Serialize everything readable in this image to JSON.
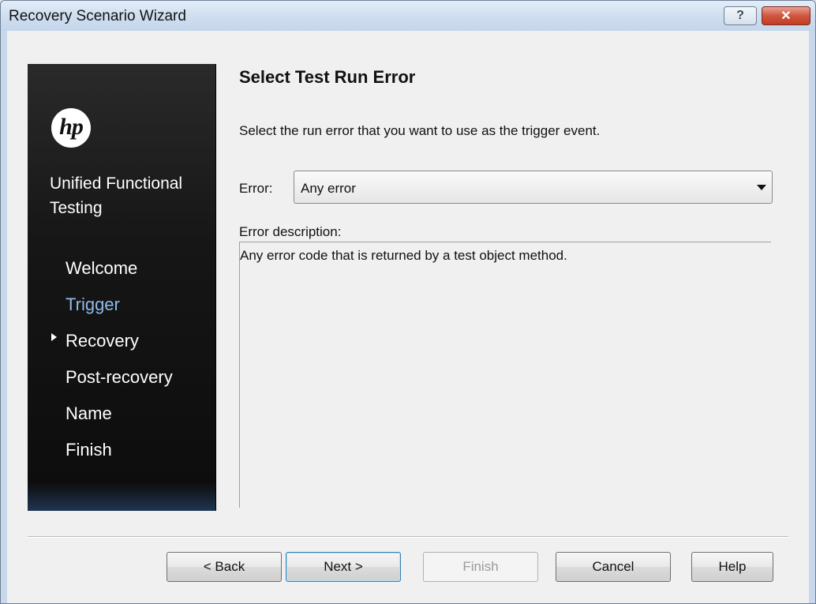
{
  "window": {
    "title": "Recovery Scenario Wizard",
    "help_glyph": "?",
    "close_glyph": "✕"
  },
  "sidebar": {
    "logo_text": "hp",
    "product_name_line1": "Unified Functional",
    "product_name_line2": "Testing",
    "active_index": 1,
    "steps": [
      {
        "label": "Welcome"
      },
      {
        "label": "Trigger"
      },
      {
        "label": "Recovery"
      },
      {
        "label": "Post-recovery"
      },
      {
        "label": "Name"
      },
      {
        "label": "Finish"
      }
    ]
  },
  "main": {
    "heading": "Select Test Run Error",
    "instruction": "Select the run error that you want to use as the trigger event.",
    "error_label": "Error:",
    "error_value": "Any error",
    "description_label": "Error description:",
    "description_text": "Any error code that is returned by a test object method."
  },
  "buttons": {
    "back": "< Back",
    "next": "Next >",
    "finish": "Finish",
    "cancel": "Cancel",
    "help": "Help"
  },
  "colors": {
    "active_step": "#8fbbe9",
    "close_button": "#c23b22",
    "default_button_border": "#3c7fb1"
  }
}
